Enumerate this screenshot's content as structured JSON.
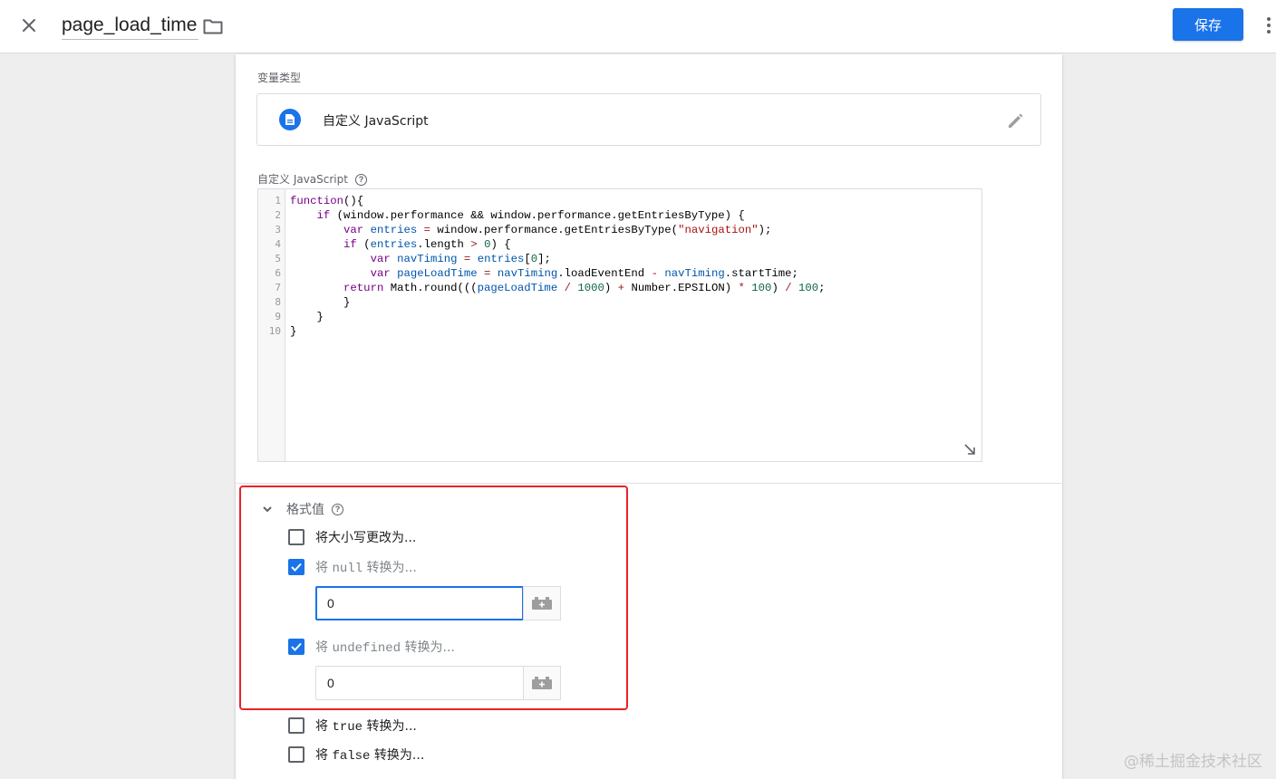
{
  "topbar": {
    "title": "page_load_time",
    "save_label": "保存"
  },
  "variable_type": {
    "section_label": "变量类型",
    "type_name": "自定义 JavaScript"
  },
  "custom_js": {
    "label": "自定义 JavaScript",
    "line_numbers": [
      "1",
      "2",
      "3",
      "4",
      "5",
      "6",
      "7",
      "8",
      "9",
      "10"
    ]
  },
  "format": {
    "title": "格式值",
    "change_case_label": "将大小写更改为...",
    "null_prefix": "将 ",
    "null_keyword": "null",
    "null_suffix": " 转换为...",
    "null_value": "0",
    "undefined_prefix": "将 ",
    "undefined_keyword": "undefined",
    "undefined_suffix": " 转换为...",
    "undefined_value": "0",
    "true_prefix": "将 ",
    "true_keyword": "true",
    "true_suffix": " 转换为...",
    "false_prefix": "将 ",
    "false_keyword": "false",
    "false_suffix": " 转换为...",
    "change_case_checked": false,
    "null_checked": true,
    "undefined_checked": true,
    "true_checked": false,
    "false_checked": false
  },
  "watermark": "@稀土掘金技术社区",
  "colors": {
    "accent": "#1a73e8",
    "highlight": "#e8222a"
  }
}
